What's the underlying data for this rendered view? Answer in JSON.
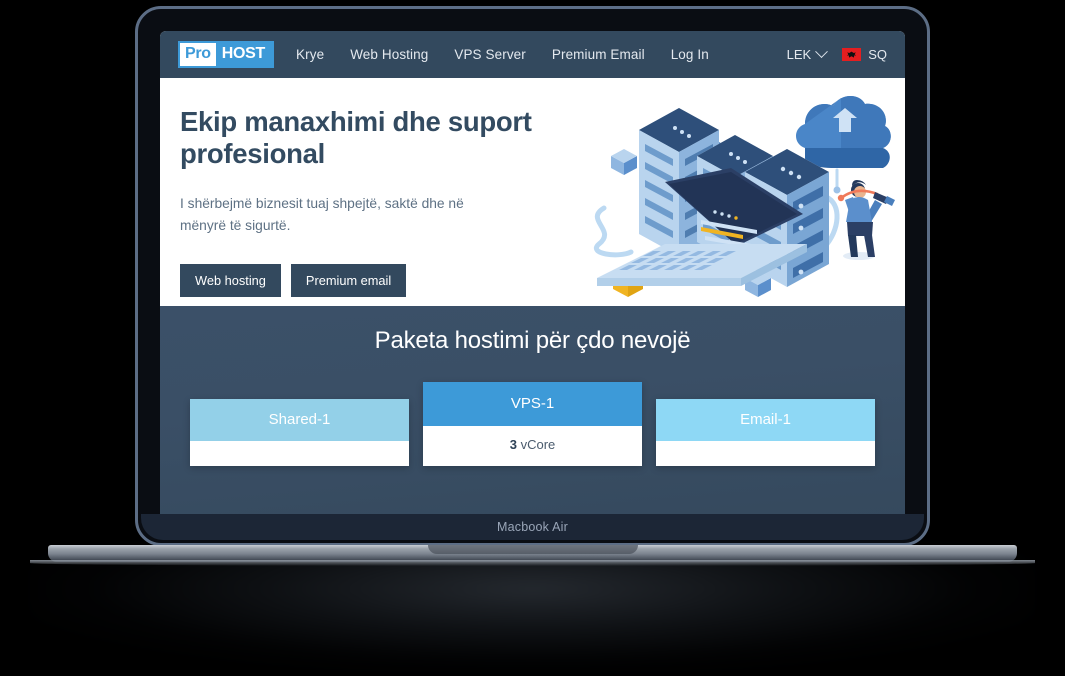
{
  "device": {
    "label": "Macbook Air"
  },
  "site": {
    "logo": {
      "part1": "Pro",
      "part2": "HOST",
      "accent_color": "#3d9ad8"
    },
    "nav": {
      "links": [
        {
          "label": "Krye",
          "name": "nav-krye"
        },
        {
          "label": "Web Hosting",
          "name": "nav-web-hosting"
        },
        {
          "label": "VPS Server",
          "name": "nav-vps-server"
        },
        {
          "label": "Premium Email",
          "name": "nav-premium-email"
        },
        {
          "label": "Log In",
          "name": "nav-log-in"
        }
      ],
      "currency": {
        "label": "LEK"
      },
      "language": {
        "label": "SQ",
        "flag": "albania-flag-icon",
        "flag_color": "#e41e20"
      }
    },
    "hero": {
      "heading": "Ekip manaxhimi dhe suport profesional",
      "subtext": "I shërbejmë biznesit tuaj shpejtë, saktë dhe në mënyrë të sigurtë.",
      "buttons": [
        {
          "label": "Web hosting",
          "name": "hero-web-hosting-button"
        },
        {
          "label": "Premium email",
          "name": "hero-premium-email-button"
        }
      ],
      "illustration": "server-cloud-hosting-illustration"
    },
    "pricing": {
      "title": "Paketa hostimi për çdo nevojë",
      "cards": [
        {
          "name": "Shared-1",
          "spec_value": "",
          "spec_label": "",
          "header_color": "#93d0e8"
        },
        {
          "name": "VPS-1",
          "spec_value": "3",
          "spec_label": "vCore",
          "header_color": "#3d9ad8"
        },
        {
          "name": "Email-1",
          "spec_value": "",
          "spec_label": "",
          "header_color": "#8ed8f5"
        }
      ]
    }
  },
  "theme": {
    "nav_bg": "#33495e",
    "pricing_bg": "#3a4f66",
    "heading_color": "#334b61",
    "page_bg": "#000000"
  }
}
